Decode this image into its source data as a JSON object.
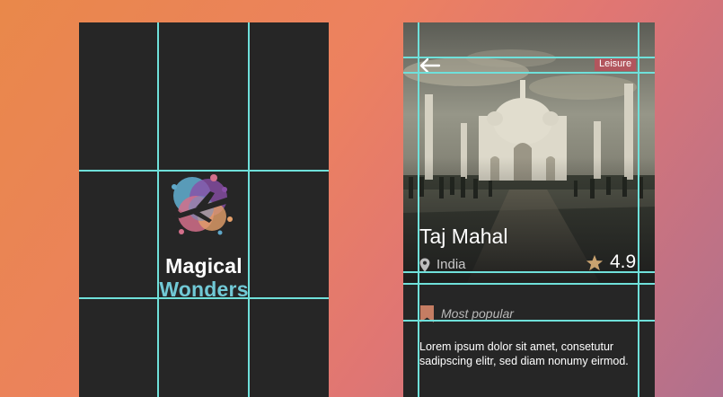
{
  "splash": {
    "brand_line1": "Magical",
    "brand_line2": "Wonders",
    "logo_icon": "airplane-logo-icon"
  },
  "detail": {
    "back_icon": "arrow-left-icon",
    "tag": "Leisure",
    "title": "Taj Mahal",
    "location_icon": "map-pin-icon",
    "location": "India",
    "rating_icon": "star-icon",
    "rating": "4.9",
    "popular_icon": "bookmark-icon",
    "popular_label": "Most popular",
    "description": "Lorem ipsum dolor sit amet, consetutur sadipscing elitr, sed diam nonumy eirmod."
  },
  "colors": {
    "guide": "#6fe0da",
    "tag": "#b2555d",
    "accent_teal": "#71c9d6",
    "star": "#c9a26f",
    "bookmark": "#c57d63",
    "card": "#262626"
  }
}
